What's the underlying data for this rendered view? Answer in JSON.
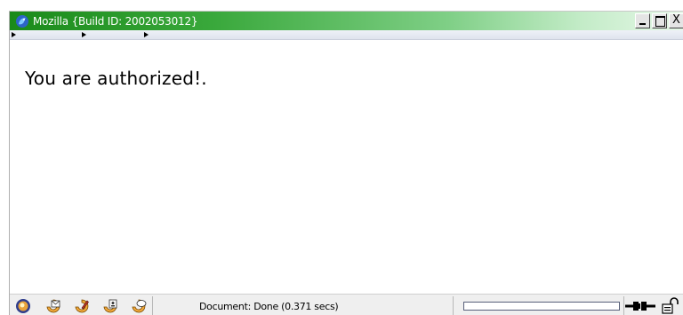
{
  "window": {
    "title": "Mozilla {Build ID: 2002053012}",
    "title_bar_colors": [
      "#1a8a1a",
      "#e6f7e8"
    ],
    "buttons": [
      "minimize-icon",
      "maximize-icon",
      "close-icon"
    ],
    "close_label": "X"
  },
  "toolbar": {
    "grippies": [
      "grippy-1",
      "grippy-2",
      "grippy-3"
    ]
  },
  "content": {
    "message": "You are authorized!."
  },
  "statusbar": {
    "component_icons": [
      "navigator-icon",
      "mail-icon",
      "composer-icon",
      "addressbook-icon",
      "chat-icon"
    ],
    "status": "Document: Done (0.371 secs)",
    "progress": 0,
    "connection_icon": "online-plug-icon",
    "security_icon": "unlocked-padlock-icon"
  }
}
